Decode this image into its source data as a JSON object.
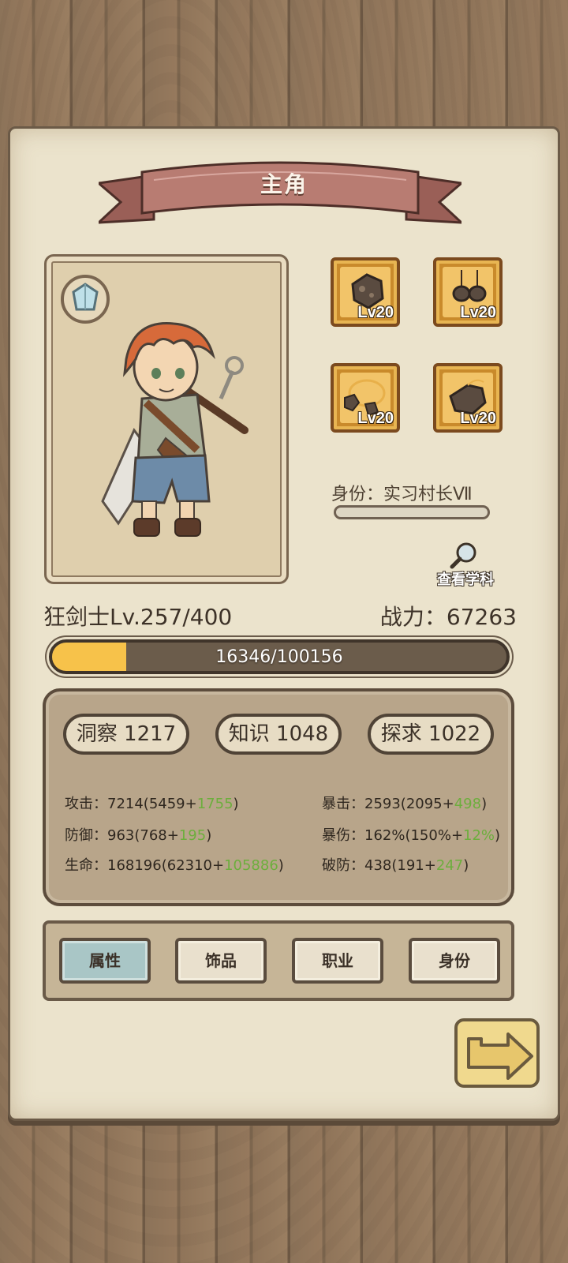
{
  "header": {
    "title": "主角"
  },
  "character": {
    "class_level": "狂剑士Lv.257/400",
    "power": "战力：67263",
    "xp_text": "16346/100156",
    "xp_fraction": 0.163
  },
  "equipment": [
    {
      "name": "rock-ore",
      "level": "Lv20"
    },
    {
      "name": "rock-earrings",
      "level": "Lv20"
    },
    {
      "name": "rock-bracelet",
      "level": "Lv20"
    },
    {
      "name": "rock-gauntlet",
      "level": "Lv20"
    }
  ],
  "identity": {
    "label": "身份：实习村长Ⅶ"
  },
  "view_subject": {
    "label": "查看学科"
  },
  "attributes": [
    {
      "label": "洞察 1217"
    },
    {
      "label": "知识 1048"
    },
    {
      "label": "探求 1022"
    }
  ],
  "stats": {
    "left": [
      {
        "base": "攻击：7214(5459+",
        "bonus": "1755",
        "end": ")"
      },
      {
        "base": "防御：963(768+",
        "bonus": "195",
        "end": ")"
      },
      {
        "base": "生命：168196(62310+",
        "bonus": "105886",
        "end": ")"
      }
    ],
    "right": [
      {
        "base": "暴击：2593(2095+",
        "bonus": "498",
        "end": ")"
      },
      {
        "base": "暴伤：162%(150%+",
        "bonus": "12%",
        "end": ")"
      },
      {
        "base": "破防：438(191+",
        "bonus": "247",
        "end": ")"
      }
    ]
  },
  "tabs": [
    {
      "label": "属性",
      "active": true
    },
    {
      "label": "饰品",
      "active": false
    },
    {
      "label": "职业",
      "active": false
    },
    {
      "label": "身份",
      "active": false
    }
  ],
  "colors": {
    "accent_bonus": "#6dae3d",
    "xp_fill": "#f7c24a",
    "active_tab": "#a9c6c6",
    "ribbon": "#b87c72"
  }
}
